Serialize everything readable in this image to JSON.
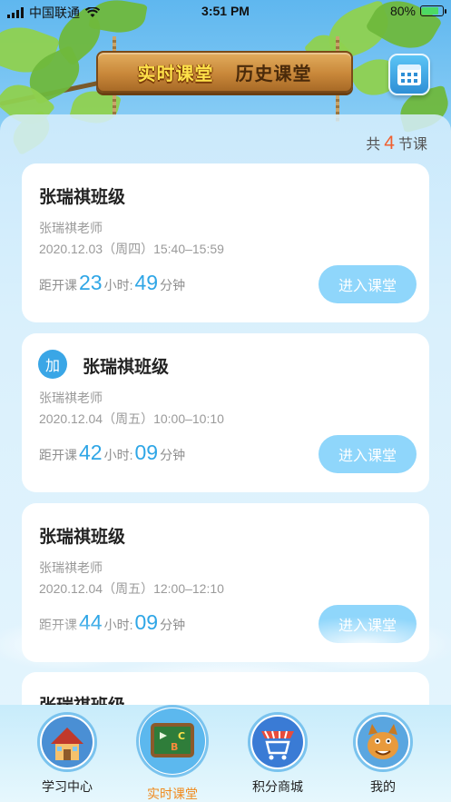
{
  "status_bar": {
    "carrier": "中国联通",
    "time": "3:51 PM",
    "battery": "80%",
    "battery_level": 0.8
  },
  "header": {
    "tabs": [
      {
        "label": "实时课堂",
        "active": true
      },
      {
        "label": "历史课堂",
        "active": false
      }
    ],
    "calendar_icon": "calendar-icon"
  },
  "summary": {
    "prefix": "共",
    "count": "4",
    "suffix": "节课"
  },
  "classes": [
    {
      "title": "张瑞祺班级",
      "badge": "",
      "teacher": "张瑞祺老师",
      "time": "2020.12.03（周四）15:40–15:59",
      "countdown_prefix": "距开课",
      "hours": "23",
      "hours_unit": "小时:",
      "minutes": "49",
      "minutes_unit": "分钟",
      "button": "进入课堂"
    },
    {
      "title": "张瑞祺班级",
      "badge": "加",
      "teacher": "张瑞祺老师",
      "time": "2020.12.04（周五）10:00–10:10",
      "countdown_prefix": "距开课",
      "hours": "42",
      "hours_unit": "小时:",
      "minutes": "09",
      "minutes_unit": "分钟",
      "button": "进入课堂"
    },
    {
      "title": "张瑞祺班级",
      "badge": "",
      "teacher": "张瑞祺老师",
      "time": "2020.12.04（周五）12:00–12:10",
      "countdown_prefix": "距开课",
      "hours": "44",
      "hours_unit": "小时:",
      "minutes": "09",
      "minutes_unit": "分钟",
      "button": "进入课堂"
    },
    {
      "title": "张瑞祺班级"
    }
  ],
  "tabbar": [
    {
      "label": "学习中心",
      "icon": "house-icon",
      "active": false
    },
    {
      "label": "实时课堂",
      "icon": "chalkboard-icon",
      "active": true
    },
    {
      "label": "积分商城",
      "icon": "shopping-cart-icon",
      "active": false
    },
    {
      "label": "我的",
      "icon": "cartoon-dog-avatar-icon",
      "active": false
    }
  ],
  "colors": {
    "accent_blue": "#2fa6e6",
    "count_orange": "#f06030",
    "button_blue": "#8fd6fb",
    "active_tab": "#f08a1c"
  }
}
